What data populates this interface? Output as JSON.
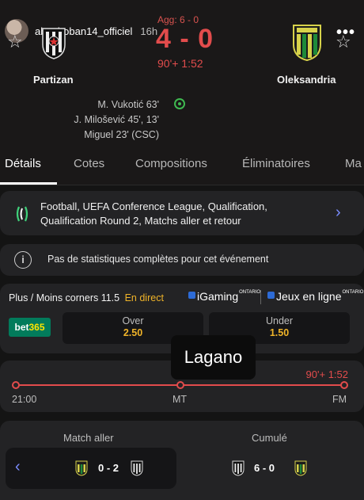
{
  "story": {
    "username": "abouboban14_officiel",
    "time_ago": "16h"
  },
  "match": {
    "aggregate": "Agg: 6 - 0",
    "score": "4 - 0",
    "clock": "90'+ 1:52",
    "home_team": "Partizan",
    "away_team": "Oleksandria",
    "scorers": [
      "M. Vukotić 63'",
      "J. Milošević 45', 13'",
      "Miguel 23' (CSC)"
    ]
  },
  "tabs": [
    {
      "label": "Détails",
      "active": true
    },
    {
      "label": "Cotes"
    },
    {
      "label": "Compositions"
    },
    {
      "label": "Éliminatoires"
    },
    {
      "label": "Ma"
    }
  ],
  "competition": {
    "text": "Football, UEFA Conference League, Qualification, Qualification Round 2, Matchs aller et retour"
  },
  "no_stats": "Pas de statistiques complètes pour cet événement",
  "odds": {
    "title": "Plus / Moins corners 11.5",
    "live": "En direct",
    "igaming": "iGaming",
    "jeux": "Jeux en ligne",
    "ontario": "ONTARIO",
    "bookmaker": "bet365",
    "over_label": "Over",
    "over_value": "2.50",
    "under_label": "Under",
    "under_value": "1.50"
  },
  "overlay_text": "Lagano",
  "timeline": {
    "clock": "90'+ 1:52",
    "start": "21:00",
    "mid": "MT",
    "end": "FM"
  },
  "legs": {
    "first_leg": "Match aller",
    "aggregate": "Cumulé",
    "first_score": "0 - 2",
    "agg_score": "6 - 0"
  },
  "colors": {
    "accent_red": "#e24c4c",
    "odds_yellow": "#f0b429",
    "link_blue": "#7a8cff",
    "bet365_green": "#027b5b"
  }
}
